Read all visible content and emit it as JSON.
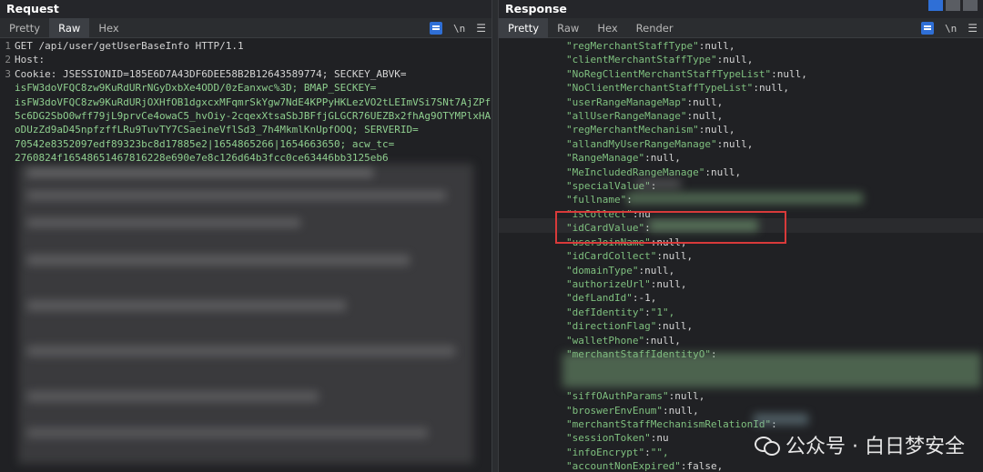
{
  "request": {
    "title": "Request",
    "tabs": [
      "Pretty",
      "Raw",
      "Hex"
    ],
    "active_tab": "Raw",
    "newline_label": "\\n",
    "lines": [
      {
        "num": "1",
        "text": "GET /api/user/getUserBaseInfo HTTP/1.1"
      },
      {
        "num": "2",
        "text": "Host: "
      },
      {
        "num": "3",
        "text": "Cookie: JSESSIONID=185E6D7A43DF6DEE58B2B12643589774; SECKEY_ABVK="
      },
      {
        "num": "",
        "text": "isFW3doVFQC8zw9KuRdURrNGyDxbXe4ODD/0zEanxwc%3D; BMAP_SECKEY="
      },
      {
        "num": "",
        "text": "isFW3doVFQC8zw9KuRdURjOXHfOB1dgxcxMFqmrSkYgw7NdE4KPPyHKLezVO2tLEImVSi7SNt7AjZPf"
      },
      {
        "num": "",
        "text": "5c6DG2SbO0wff79jL9prvCe4owaC5_hvOiy-2cqexXtsaSbJBFfjGLGCR76UEZBx2fhAg9OTYMPlxHA"
      },
      {
        "num": "",
        "text": "oDUzZd9aD45npfzffLRu9TuvTY7CSaeineVflSd3_7h4MkmlKnUpfOOQ; SERVERID="
      },
      {
        "num": "",
        "text": "70542e8352097edf89323bc8d17885e2|1654865266|1654663650; acw_tc="
      },
      {
        "num": "",
        "text": "2760824f16548651467816228e690e7e8c126d64b3fcc0ce63446bb3125eb6"
      }
    ]
  },
  "response": {
    "title": "Response",
    "tabs": [
      "Pretty",
      "Raw",
      "Hex",
      "Render"
    ],
    "active_tab": "Pretty",
    "newline_label": "\\n",
    "lines": [
      {
        "key": "regMerchantStaffType",
        "val": "null,"
      },
      {
        "key": "clientMerchantStaffType",
        "val": "null,"
      },
      {
        "key": "NoRegClientMerchantStaffTypeList",
        "val": "null,"
      },
      {
        "key": "NoClientMerchantStaffTypeList",
        "val": "null,"
      },
      {
        "key": "userRangeManageMap",
        "val": "null,"
      },
      {
        "key": "allUserRangeManage",
        "val": "null,"
      },
      {
        "key": "regMerchantMechanism",
        "val": "null,"
      },
      {
        "key": "allandMyUserRangeManage",
        "val": "null,"
      },
      {
        "key": "RangeManage",
        "val": "null,"
      },
      {
        "key": "MeIncludedRangeManage",
        "val": "null,"
      },
      {
        "key": "specialValue",
        "val": ""
      },
      {
        "key": "fullname",
        "val": ""
      },
      {
        "key": "isCollect",
        "val": "nu"
      },
      {
        "key": "idCardValue",
        "val": ""
      },
      {
        "key": "userJoinName",
        "val": "null,"
      },
      {
        "key": "idCardCollect",
        "val": "null,"
      },
      {
        "key": "domainType",
        "val": "null,"
      },
      {
        "key": "authorizeUrl",
        "val": "null,"
      },
      {
        "key": "defLandId",
        "val": "-1,"
      },
      {
        "key": "defIdentity",
        "val": "\"1\","
      },
      {
        "key": "directionFlag",
        "val": "null,"
      },
      {
        "key": "walletPhone",
        "val": "null,"
      },
      {
        "key": "merchantStaffIdentityO",
        "val": ""
      },
      {
        "key": "",
        "val": ""
      },
      {
        "key": "",
        "val": ""
      },
      {
        "key": "siffOAuthParams",
        "val": "null,"
      },
      {
        "key": "broswerEnvEnum",
        "val": "null,"
      },
      {
        "key": "merchantStaffMechanismRelationId",
        "val": ""
      },
      {
        "key": "sessionToken",
        "val": "nu"
      },
      {
        "key": "infoEncrypt",
        "val": "\"\","
      },
      {
        "key": "accountNonExpired",
        "val": "false,"
      }
    ]
  },
  "watermark": {
    "text": "公众号 · 白日梦安全"
  }
}
